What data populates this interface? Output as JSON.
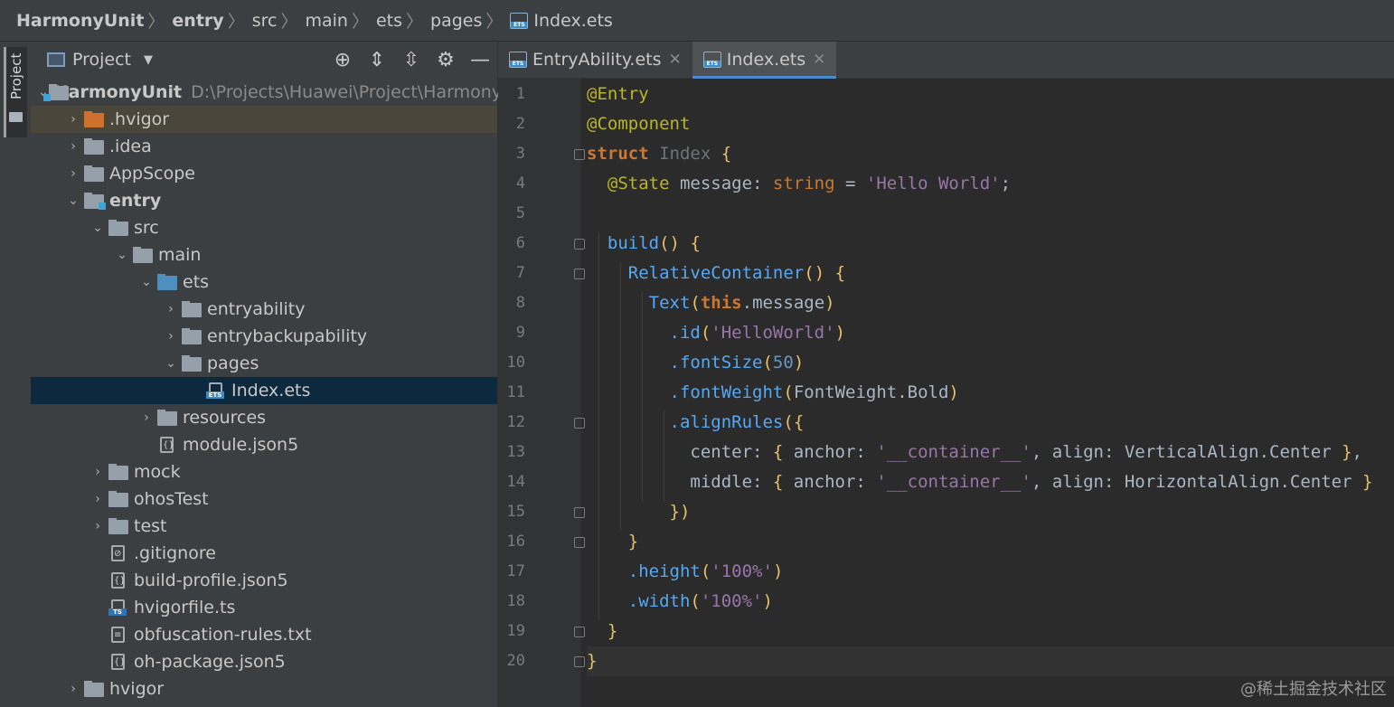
{
  "breadcrumb": {
    "items": [
      "HarmonyUnit",
      "entry",
      "src",
      "main",
      "ets",
      "pages",
      "Index.ets"
    ]
  },
  "toolstrip": {
    "project_tab": "Project"
  },
  "project_panel": {
    "title": "Project",
    "tools": [
      "locate-icon",
      "expand-all-icon",
      "collapse-all-icon",
      "gear-icon",
      "minimize-icon"
    ]
  },
  "tree": [
    {
      "label": "HarmonyUnit",
      "path": "D:\\Projects\\Huawei\\Project\\Harmony",
      "depth": 0,
      "arrow": "down",
      "icon": "module-folder-icon",
      "bold": true
    },
    {
      "label": ".hvigor",
      "depth": 1,
      "arrow": "right",
      "icon": "orange-folder-icon"
    },
    {
      "label": ".idea",
      "depth": 1,
      "arrow": "right",
      "icon": "folder-icon"
    },
    {
      "label": "AppScope",
      "depth": 1,
      "arrow": "right",
      "icon": "folder-icon"
    },
    {
      "label": "entry",
      "depth": 1,
      "arrow": "down",
      "icon": "module-folder-icon",
      "bold": true
    },
    {
      "label": "src",
      "depth": 2,
      "arrow": "down",
      "icon": "folder-icon"
    },
    {
      "label": "main",
      "depth": 3,
      "arrow": "down",
      "icon": "folder-icon"
    },
    {
      "label": "ets",
      "depth": 4,
      "arrow": "down",
      "icon": "blue-folder-icon"
    },
    {
      "label": "entryability",
      "depth": 5,
      "arrow": "right",
      "icon": "folder-icon"
    },
    {
      "label": "entrybackupability",
      "depth": 5,
      "arrow": "right",
      "icon": "folder-icon"
    },
    {
      "label": "pages",
      "depth": 5,
      "arrow": "down",
      "icon": "folder-icon"
    },
    {
      "label": "Index.ets",
      "depth": 6,
      "arrow": "",
      "icon": "ets-file-icon"
    },
    {
      "label": "resources",
      "depth": 4,
      "arrow": "right",
      "icon": "folder-icon"
    },
    {
      "label": "module.json5",
      "depth": 4,
      "arrow": "",
      "icon": "json-file-icon"
    },
    {
      "label": "mock",
      "depth": 2,
      "arrow": "right",
      "icon": "folder-icon"
    },
    {
      "label": "ohosTest",
      "depth": 2,
      "arrow": "right",
      "icon": "folder-icon"
    },
    {
      "label": "test",
      "depth": 2,
      "arrow": "right",
      "icon": "folder-icon"
    },
    {
      "label": ".gitignore",
      "depth": 2,
      "arrow": "",
      "icon": "gitignore-file-icon"
    },
    {
      "label": "build-profile.json5",
      "depth": 2,
      "arrow": "",
      "icon": "json-file-icon"
    },
    {
      "label": "hvigorfile.ts",
      "depth": 2,
      "arrow": "",
      "icon": "ts-file-icon"
    },
    {
      "label": "obfuscation-rules.txt",
      "depth": 2,
      "arrow": "",
      "icon": "text-file-icon"
    },
    {
      "label": "oh-package.json5",
      "depth": 2,
      "arrow": "",
      "icon": "json-file-icon"
    },
    {
      "label": "hvigor",
      "depth": 1,
      "arrow": "right",
      "icon": "folder-icon"
    }
  ],
  "editor": {
    "tabs": [
      {
        "label": "EntryAbility.ets",
        "active": false
      },
      {
        "label": "Index.ets",
        "active": true
      }
    ],
    "line_numbers": [
      "1",
      "2",
      "3",
      "4",
      "5",
      "6",
      "7",
      "8",
      "9",
      "10",
      "11",
      "12",
      "13",
      "14",
      "15",
      "16",
      "17",
      "18",
      "19",
      "20"
    ],
    "code_lines": [
      "@Entry",
      "@Component",
      "struct Index {",
      "  @State message: string = 'Hello World';",
      "",
      "  build() {",
      "    RelativeContainer() {",
      "      Text(this.message)",
      "        .id('HelloWorld')",
      "        .fontSize(50)",
      "        .fontWeight(FontWeight.Bold)",
      "        .alignRules({",
      "          center: { anchor: '__container__', align: VerticalAlign.Center },",
      "          middle: { anchor: '__container__', align: HorizontalAlign.Center }",
      "        })",
      "    }",
      "    .height('100%')",
      "    .width('100%')",
      "  }",
      "}"
    ]
  },
  "watermark": "@稀土掘金技术社区"
}
